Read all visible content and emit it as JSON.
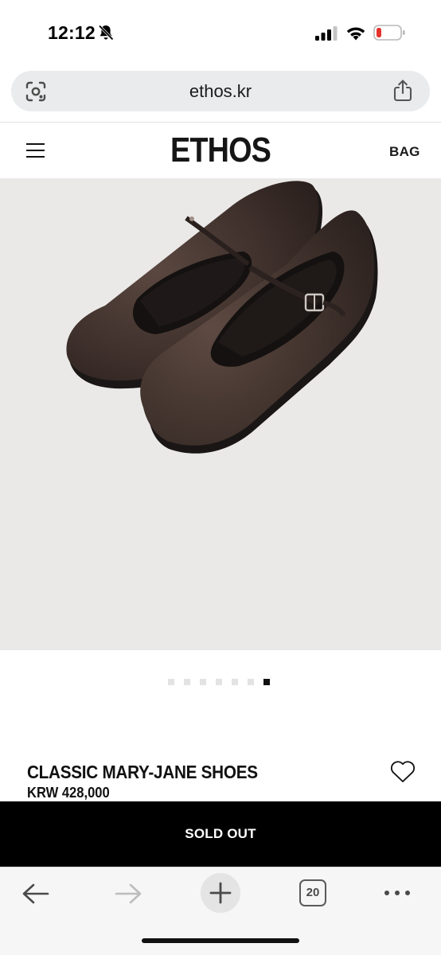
{
  "status_bar": {
    "time": "12:12",
    "icons": [
      "bell-slash-icon",
      "signal-icon",
      "wifi-icon",
      "battery-low-icon"
    ],
    "battery_color": "#e5322d"
  },
  "browser": {
    "url": "ethos.kr",
    "tab_count": "20",
    "toolbar_icons": [
      "back-arrow-icon",
      "forward-arrow-icon",
      "plus-icon",
      "tabs-icon",
      "more-dots-icon"
    ]
  },
  "site": {
    "logo": "ETHOS",
    "bag_label": "BAG",
    "menu_icon": "hamburger-icon"
  },
  "gallery": {
    "image_subject": "dark brown leather mary-jane shoes",
    "dot_count": 7,
    "active_index": 6
  },
  "product": {
    "name": "CLASSIC MARY-JANE SHOES",
    "price": "KRW 428,000",
    "wishlist_icon": "heart-outline-icon",
    "cta_label": "SOLD OUT"
  },
  "colors": {
    "background": "#ffffff",
    "image_background": "#ebe9e8",
    "cta_background": "#000000",
    "cta_text": "#ffffff",
    "shoe": "#3e302b"
  }
}
